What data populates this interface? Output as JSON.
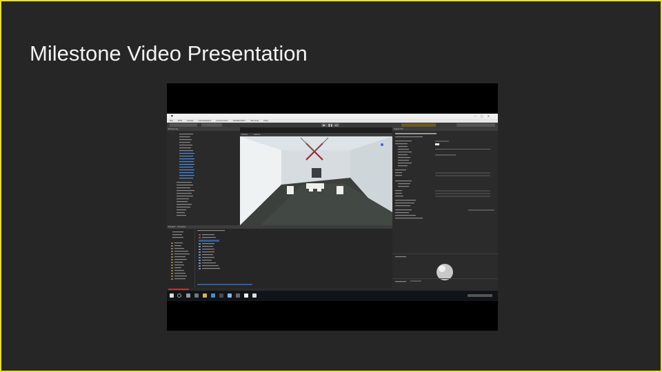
{
  "slide": {
    "title": "Milestone Video Presentation",
    "border_color": "#e8e02a",
    "background_color": "#262626"
  },
  "video": {
    "content": "Unity Editor screen recording",
    "editor_panels": {
      "hierarchy": "Hierarchy",
      "scene": "Scene",
      "game": "Game",
      "inspector": "Inspector",
      "project": "Project",
      "console": "Console"
    },
    "menu": [
      "File",
      "Edit",
      "Assets",
      "GameObject",
      "Component",
      "TextMeshPro",
      "Window",
      "Help"
    ]
  },
  "icons": [
    "unity-icon",
    "windows-start-icon",
    "search-icon",
    "gizmo-icon",
    "material-sphere-icon",
    "play-icon",
    "pause-icon",
    "step-icon"
  ]
}
